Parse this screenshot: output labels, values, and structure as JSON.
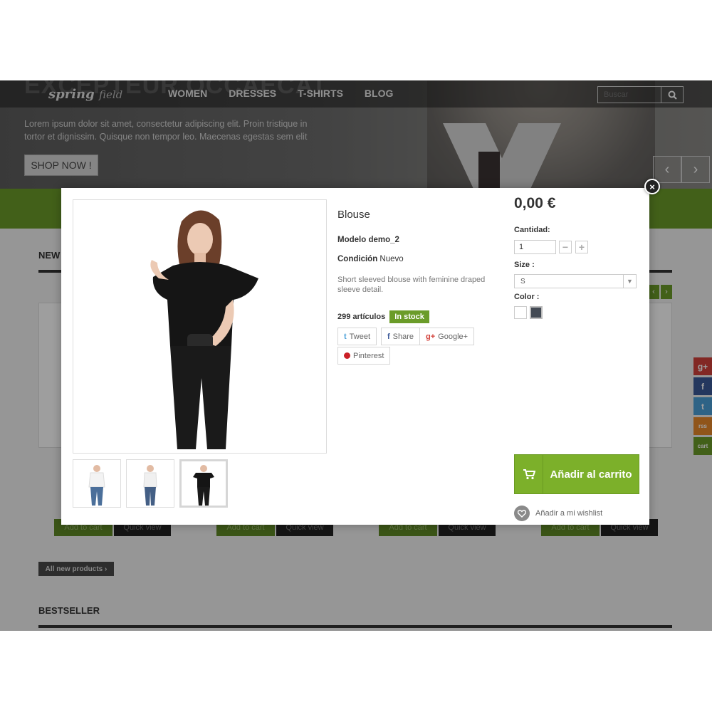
{
  "header": {
    "ghost_title": "EXCEPTEUR OCCAECAT",
    "logo_main": "spring",
    "logo_script": "field",
    "nav": [
      "WOMEN",
      "DRESSES",
      "T-SHIRTS",
      "BLOG"
    ],
    "search_placeholder": "Buscar",
    "search_icon": "search-icon"
  },
  "hero": {
    "text": "Lorem ipsum dolor sit amet, consectetur adipiscing elit. Proin tristique in tortor et dignissim. Quisque non tempor leo. Maecenas egestas sem elit",
    "button": "SHOP NOW !",
    "prev": "‹",
    "next": "›"
  },
  "background": {
    "new_heading": "NEW",
    "add_to_cart": "Add to cart",
    "quick_view": "Quick view",
    "all_new": "All new products",
    "bestseller": "BESTSELLER",
    "side_social": [
      "g+",
      "f",
      "t",
      "rss",
      "cart"
    ]
  },
  "modal": {
    "close": "×",
    "title": "Blouse",
    "model_label": "Modelo",
    "model_value": "demo_2",
    "condition_label": "Condición",
    "condition_value": "Nuevo",
    "description": "Short sleeved blouse with feminine draped sleeve detail.",
    "quantity_available": "299 artículos",
    "stock_badge": "In stock",
    "share": {
      "tweet": "Tweet",
      "share": "Share",
      "google": "Google+",
      "pinterest": "Pinterest"
    },
    "price": "0,00 €",
    "qty_label": "Cantidad:",
    "qty_value": "1",
    "size_label": "Size :",
    "size_value": "S",
    "color_label": "Color :",
    "colors": [
      "#ffffff",
      "#434a54"
    ],
    "add_to_cart": "Añadir al carrito",
    "wishlist": "Añadir a mi wishlist"
  },
  "colors": {
    "accent": "#7cb02a",
    "dark": "#333333"
  }
}
